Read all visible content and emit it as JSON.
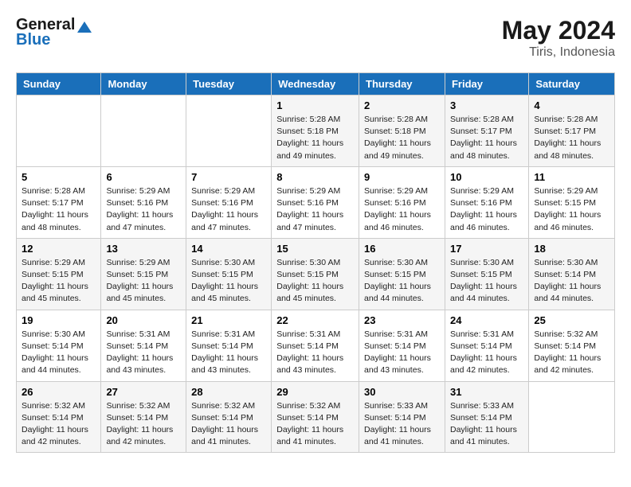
{
  "header": {
    "logo_general": "General",
    "logo_blue": "Blue",
    "month_title": "May 2024",
    "location": "Tiris, Indonesia"
  },
  "days_of_week": [
    "Sunday",
    "Monday",
    "Tuesday",
    "Wednesday",
    "Thursday",
    "Friday",
    "Saturday"
  ],
  "weeks": [
    {
      "days": [
        {
          "num": "",
          "info": ""
        },
        {
          "num": "",
          "info": ""
        },
        {
          "num": "",
          "info": ""
        },
        {
          "num": "1",
          "info": "Sunrise: 5:28 AM\nSunset: 5:18 PM\nDaylight: 11 hours\nand 49 minutes."
        },
        {
          "num": "2",
          "info": "Sunrise: 5:28 AM\nSunset: 5:18 PM\nDaylight: 11 hours\nand 49 minutes."
        },
        {
          "num": "3",
          "info": "Sunrise: 5:28 AM\nSunset: 5:17 PM\nDaylight: 11 hours\nand 48 minutes."
        },
        {
          "num": "4",
          "info": "Sunrise: 5:28 AM\nSunset: 5:17 PM\nDaylight: 11 hours\nand 48 minutes."
        }
      ]
    },
    {
      "days": [
        {
          "num": "5",
          "info": "Sunrise: 5:28 AM\nSunset: 5:17 PM\nDaylight: 11 hours\nand 48 minutes."
        },
        {
          "num": "6",
          "info": "Sunrise: 5:29 AM\nSunset: 5:16 PM\nDaylight: 11 hours\nand 47 minutes."
        },
        {
          "num": "7",
          "info": "Sunrise: 5:29 AM\nSunset: 5:16 PM\nDaylight: 11 hours\nand 47 minutes."
        },
        {
          "num": "8",
          "info": "Sunrise: 5:29 AM\nSunset: 5:16 PM\nDaylight: 11 hours\nand 47 minutes."
        },
        {
          "num": "9",
          "info": "Sunrise: 5:29 AM\nSunset: 5:16 PM\nDaylight: 11 hours\nand 46 minutes."
        },
        {
          "num": "10",
          "info": "Sunrise: 5:29 AM\nSunset: 5:16 PM\nDaylight: 11 hours\nand 46 minutes."
        },
        {
          "num": "11",
          "info": "Sunrise: 5:29 AM\nSunset: 5:15 PM\nDaylight: 11 hours\nand 46 minutes."
        }
      ]
    },
    {
      "days": [
        {
          "num": "12",
          "info": "Sunrise: 5:29 AM\nSunset: 5:15 PM\nDaylight: 11 hours\nand 45 minutes."
        },
        {
          "num": "13",
          "info": "Sunrise: 5:29 AM\nSunset: 5:15 PM\nDaylight: 11 hours\nand 45 minutes."
        },
        {
          "num": "14",
          "info": "Sunrise: 5:30 AM\nSunset: 5:15 PM\nDaylight: 11 hours\nand 45 minutes."
        },
        {
          "num": "15",
          "info": "Sunrise: 5:30 AM\nSunset: 5:15 PM\nDaylight: 11 hours\nand 45 minutes."
        },
        {
          "num": "16",
          "info": "Sunrise: 5:30 AM\nSunset: 5:15 PM\nDaylight: 11 hours\nand 44 minutes."
        },
        {
          "num": "17",
          "info": "Sunrise: 5:30 AM\nSunset: 5:15 PM\nDaylight: 11 hours\nand 44 minutes."
        },
        {
          "num": "18",
          "info": "Sunrise: 5:30 AM\nSunset: 5:14 PM\nDaylight: 11 hours\nand 44 minutes."
        }
      ]
    },
    {
      "days": [
        {
          "num": "19",
          "info": "Sunrise: 5:30 AM\nSunset: 5:14 PM\nDaylight: 11 hours\nand 44 minutes."
        },
        {
          "num": "20",
          "info": "Sunrise: 5:31 AM\nSunset: 5:14 PM\nDaylight: 11 hours\nand 43 minutes."
        },
        {
          "num": "21",
          "info": "Sunrise: 5:31 AM\nSunset: 5:14 PM\nDaylight: 11 hours\nand 43 minutes."
        },
        {
          "num": "22",
          "info": "Sunrise: 5:31 AM\nSunset: 5:14 PM\nDaylight: 11 hours\nand 43 minutes."
        },
        {
          "num": "23",
          "info": "Sunrise: 5:31 AM\nSunset: 5:14 PM\nDaylight: 11 hours\nand 43 minutes."
        },
        {
          "num": "24",
          "info": "Sunrise: 5:31 AM\nSunset: 5:14 PM\nDaylight: 11 hours\nand 42 minutes."
        },
        {
          "num": "25",
          "info": "Sunrise: 5:32 AM\nSunset: 5:14 PM\nDaylight: 11 hours\nand 42 minutes."
        }
      ]
    },
    {
      "days": [
        {
          "num": "26",
          "info": "Sunrise: 5:32 AM\nSunset: 5:14 PM\nDaylight: 11 hours\nand 42 minutes."
        },
        {
          "num": "27",
          "info": "Sunrise: 5:32 AM\nSunset: 5:14 PM\nDaylight: 11 hours\nand 42 minutes."
        },
        {
          "num": "28",
          "info": "Sunrise: 5:32 AM\nSunset: 5:14 PM\nDaylight: 11 hours\nand 41 minutes."
        },
        {
          "num": "29",
          "info": "Sunrise: 5:32 AM\nSunset: 5:14 PM\nDaylight: 11 hours\nand 41 minutes."
        },
        {
          "num": "30",
          "info": "Sunrise: 5:33 AM\nSunset: 5:14 PM\nDaylight: 11 hours\nand 41 minutes."
        },
        {
          "num": "31",
          "info": "Sunrise: 5:33 AM\nSunset: 5:14 PM\nDaylight: 11 hours\nand 41 minutes."
        },
        {
          "num": "",
          "info": ""
        }
      ]
    }
  ]
}
